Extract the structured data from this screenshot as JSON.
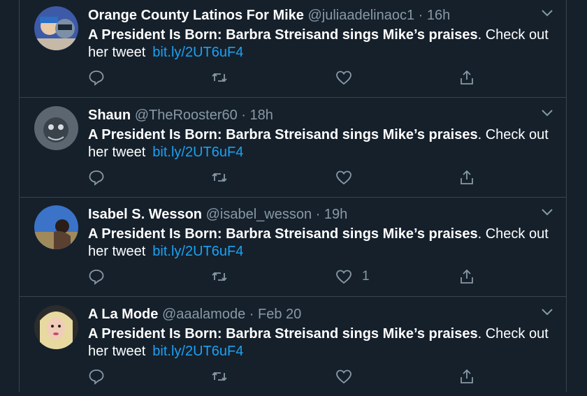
{
  "colors": {
    "background": "#15202b",
    "text": "#ffffff",
    "secondary": "#8899a6",
    "link": "#1da1f2",
    "border": "#38444d"
  },
  "tweets": [
    {
      "name": "Orange County Latinos For Mike",
      "meta": "@juliaadelinaoc1 · 16h",
      "headline": "A President Is Born: Barbra Streisand sings Mike’s praises",
      "rest": ". Check out her tweet",
      "link": "bit.ly/2UT6uF4",
      "reply_icon": "reply-icon",
      "retweet_icon": "retweet-icon",
      "like_icon": "heart-icon",
      "share_icon": "share-icon",
      "likes": ""
    },
    {
      "name": "Shaun",
      "meta": "@TheRooster60 · 18h",
      "headline": "A President Is Born: Barbra Streisand sings Mike’s praises",
      "rest": ". Check out her tweet",
      "link": "bit.ly/2UT6uF4",
      "likes": ""
    },
    {
      "name": "Isabel S. Wesson",
      "meta": "@isabel_wesson · 19h",
      "headline": "A President Is Born: Barbra Streisand sings Mike’s praises",
      "rest": ". Check out her tweet",
      "link": "bit.ly/2UT6uF4",
      "likes": "1"
    },
    {
      "name": "A La Mode",
      "meta": "@aaalamode · Feb 20",
      "headline": "A President Is Born: Barbra Streisand sings Mike’s praises",
      "rest": ". Check out her tweet",
      "link": "bit.ly/2UT6uF4",
      "likes": ""
    }
  ]
}
